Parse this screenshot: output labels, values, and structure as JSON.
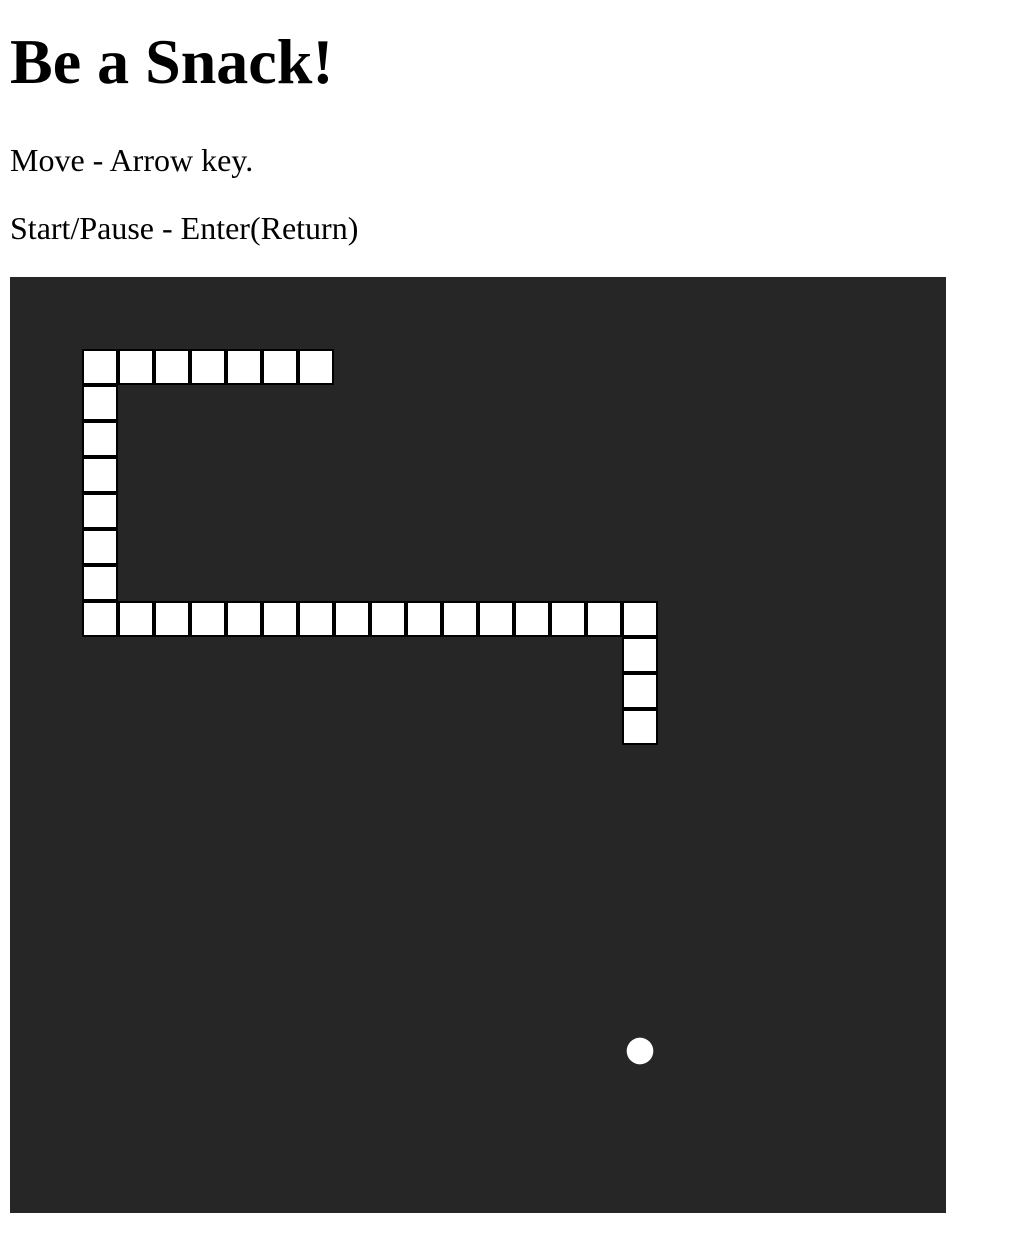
{
  "header": {
    "title": "Be a Snack!"
  },
  "instructions": {
    "move": "Move - Arrow key.",
    "start_pause": "Start/Pause - Enter(Return)"
  },
  "game": {
    "board_color": "#262626",
    "snake_color": "#ffffff",
    "snake_outline_color": "#000000",
    "food_color": "#ffffff",
    "grid_columns": 26,
    "grid_rows": 26,
    "snake_segments": [
      {
        "col": 8,
        "row": 2
      },
      {
        "col": 7,
        "row": 2
      },
      {
        "col": 6,
        "row": 2
      },
      {
        "col": 5,
        "row": 2
      },
      {
        "col": 4,
        "row": 2
      },
      {
        "col": 3,
        "row": 2
      },
      {
        "col": 2,
        "row": 2
      },
      {
        "col": 2,
        "row": 3
      },
      {
        "col": 2,
        "row": 4
      },
      {
        "col": 2,
        "row": 5
      },
      {
        "col": 2,
        "row": 6
      },
      {
        "col": 2,
        "row": 7
      },
      {
        "col": 2,
        "row": 8
      },
      {
        "col": 2,
        "row": 9
      },
      {
        "col": 3,
        "row": 9
      },
      {
        "col": 4,
        "row": 9
      },
      {
        "col": 5,
        "row": 9
      },
      {
        "col": 6,
        "row": 9
      },
      {
        "col": 7,
        "row": 9
      },
      {
        "col": 8,
        "row": 9
      },
      {
        "col": 9,
        "row": 9
      },
      {
        "col": 10,
        "row": 9
      },
      {
        "col": 11,
        "row": 9
      },
      {
        "col": 12,
        "row": 9
      },
      {
        "col": 13,
        "row": 9
      },
      {
        "col": 14,
        "row": 9
      },
      {
        "col": 15,
        "row": 9
      },
      {
        "col": 16,
        "row": 9
      },
      {
        "col": 17,
        "row": 9
      },
      {
        "col": 17,
        "row": 10
      },
      {
        "col": 17,
        "row": 11
      },
      {
        "col": 17,
        "row": 12
      }
    ],
    "food": {
      "col": 17,
      "row": 21
    }
  }
}
